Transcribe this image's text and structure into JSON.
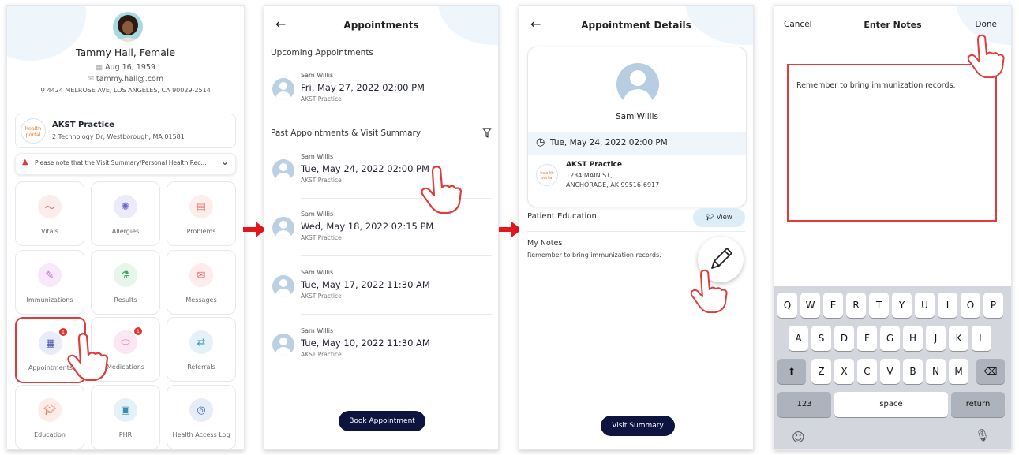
{
  "screen1": {
    "patient": {
      "name": "Tammy Hall, Female",
      "dob": "Aug 16, 1959",
      "email": "tammy.hall@.com",
      "address": "4424 MELROSE AVE, LOS ANGELES, CA 90029-2514"
    },
    "practice": {
      "name": "AKST Practice",
      "address": "2 Technology Dr, Westborough, MA 01581",
      "logo_text": "health portal"
    },
    "notice": "Please note that the Visit Summary/Personal Health Rec...",
    "tiles": [
      "Vitals",
      "Allergies",
      "Problems",
      "Immunizations",
      "Results",
      "Messages",
      "Appointments",
      "Medications",
      "Referrals",
      "Education",
      "PHR",
      "Health Access Log"
    ],
    "badges": {
      "appointments": "1",
      "medications": "1"
    }
  },
  "screen2": {
    "title": "Appointments",
    "upcoming_title": "Upcoming Appointments",
    "past_title": "Past Appointments & Visit Summary",
    "upcoming": {
      "name": "Sam Willis",
      "date": "Fri, May 27, 2022 02:00 PM",
      "practice": "AKST Practice"
    },
    "past": [
      {
        "name": "Sam Willis",
        "date": "Tue, May 24, 2022 02:00 PM",
        "practice": "AKST Practice"
      },
      {
        "name": "Sam Willis",
        "date": "Wed, May 18, 2022 02:15 PM",
        "practice": "AKST Practice"
      },
      {
        "name": "Sam Willis",
        "date": "Tue, May 17, 2022 11:30 AM",
        "practice": "AKST Practice"
      },
      {
        "name": "Sam Willis",
        "date": "Tue, May 10, 2022 11:30 AM",
        "practice": "AKST Practice"
      }
    ],
    "book_button": "Book Appointment"
  },
  "screen3": {
    "title": "Appointment Details",
    "provider": "Sam Willis",
    "datetime": "Tue, May 24, 2022 02:00 PM",
    "practice_name": "AKST Practice",
    "practice_addr1": "1234 MAIN ST,",
    "practice_addr2": "ANCHORAGE, AK 99516-6917",
    "education_label": "Patient Education",
    "view_button": "View",
    "notes_label": "My Notes",
    "notes_text": "Remember to bring immunization records.",
    "visit_summary_button": "Visit Summary"
  },
  "screen4": {
    "cancel": "Cancel",
    "title": "Enter Notes",
    "done": "Done",
    "notes_text": "Remember to bring immunization records.",
    "row1": [
      "Q",
      "W",
      "E",
      "R",
      "T",
      "Y",
      "U",
      "I",
      "O",
      "P"
    ],
    "row2": [
      "A",
      "S",
      "D",
      "F",
      "G",
      "H",
      "J",
      "K",
      "L"
    ],
    "row3": [
      "Z",
      "X",
      "C",
      "V",
      "B",
      "N",
      "M"
    ],
    "key_123": "123",
    "key_space": "space",
    "key_return": "return"
  },
  "colors": {
    "accent_red": "#e03c3c",
    "navy": "#0d1440",
    "pale_blue": "#dcedf7"
  }
}
